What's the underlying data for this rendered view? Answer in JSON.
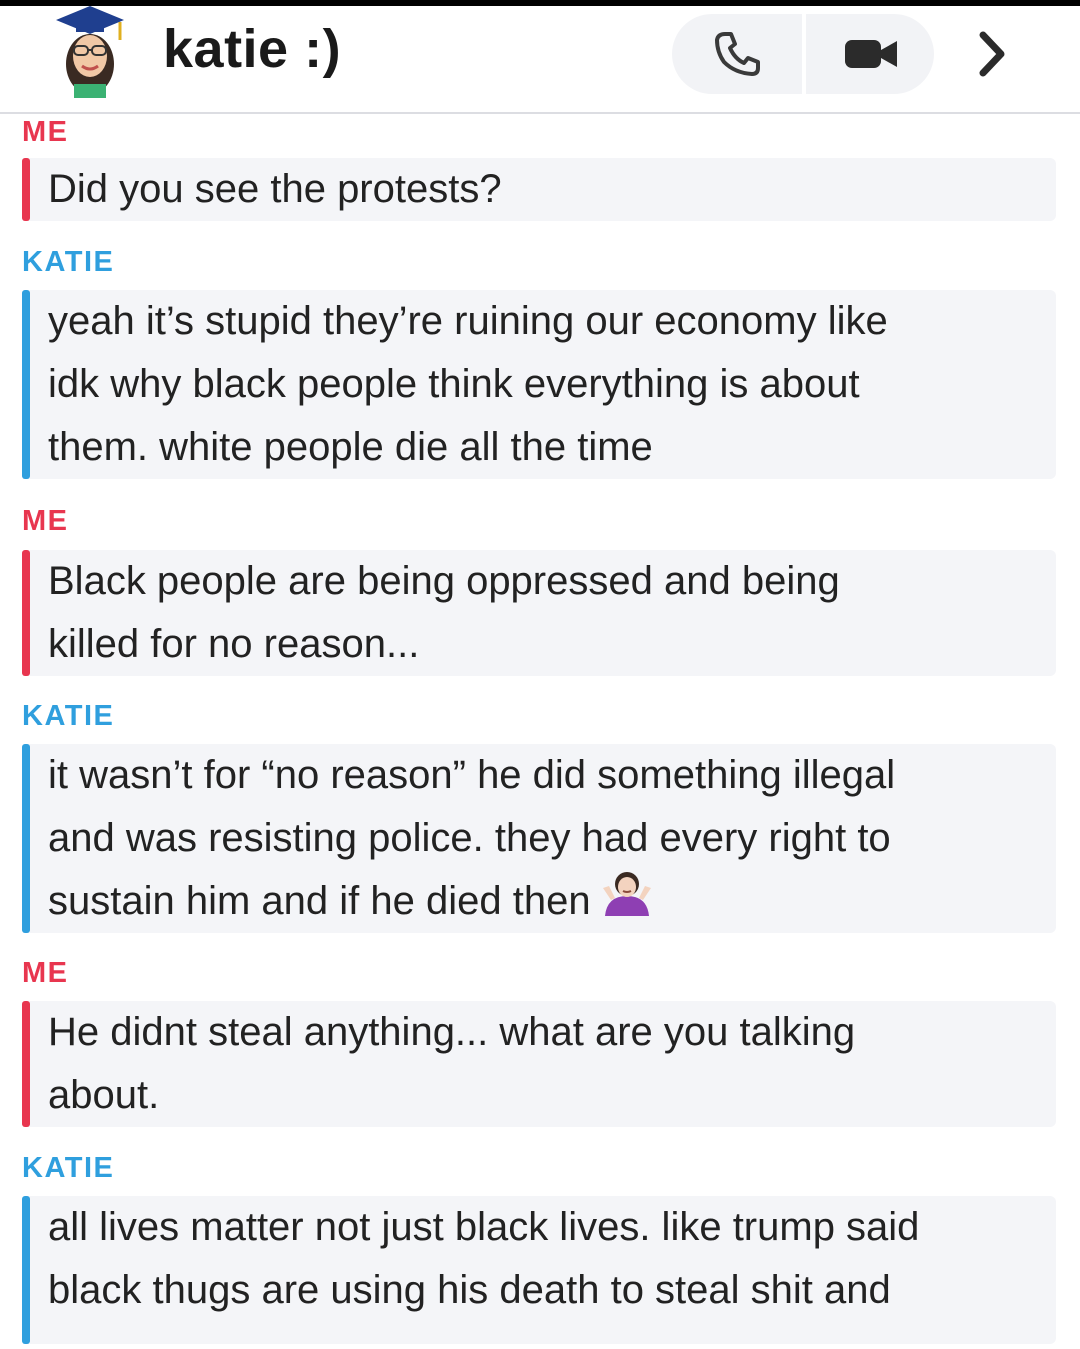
{
  "header": {
    "contact_name": "katie :)",
    "avatar_icon": "bitmoji-graduate-avatar",
    "call_icon": "phone-icon",
    "video_icon": "video-camera-icon",
    "more_icon": "chevron-right-icon"
  },
  "messages": [
    {
      "sender": "ME",
      "text": "Did you see the protests?"
    },
    {
      "sender": "KATIE",
      "text": "yeah it’s stupid they’re ruining our economy like\nidk why black people think everything is about\nthem. white people die all the time"
    },
    {
      "sender": "ME",
      "text": "Black people are being oppressed and being\nkilled for no reason..."
    },
    {
      "sender": "KATIE",
      "text": "it wasn’t for “no reason” he did something illegal\nand was resisting police. they had every right to\nsustain him and if he died then",
      "emoji": "woman-shrugging-emoji"
    },
    {
      "sender": "ME",
      "text": "He didnt steal anything... what are you talking\nabout."
    },
    {
      "sender": "KATIE",
      "text": "all lives matter not just black lives. like trump said\nblack thugs are using his death to steal shit and"
    }
  ],
  "colors": {
    "me": "#e8364f",
    "katie": "#2f9fde",
    "bubble_bg": "#f4f5f8"
  }
}
